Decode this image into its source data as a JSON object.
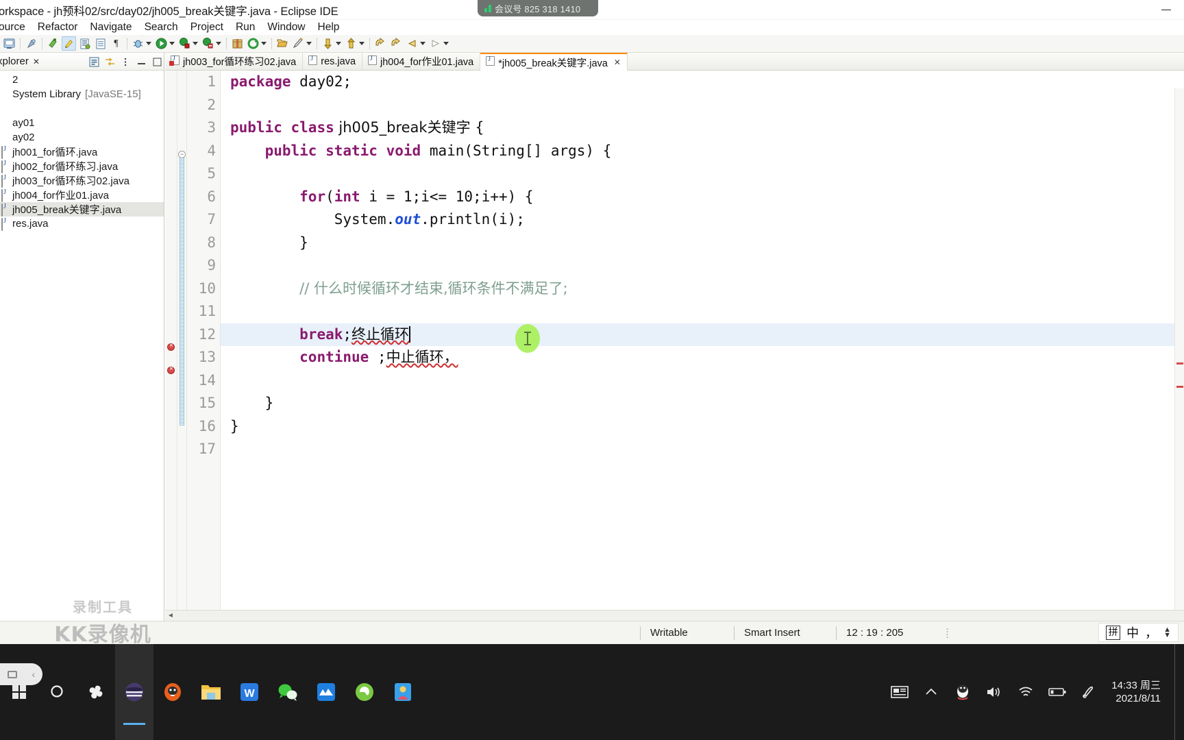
{
  "window": {
    "title": "orkspace - jh预科02/src/day02/jh005_break关键字.java - Eclipse IDE",
    "minimize_label": "—"
  },
  "meeting_overlay": {
    "label": "会议号 825 318 1410"
  },
  "menubar": {
    "items": [
      {
        "label": "ource"
      },
      {
        "label": "Refactor"
      },
      {
        "label": "Navigate"
      },
      {
        "label": "Search"
      },
      {
        "label": "Project"
      },
      {
        "label": "Run"
      },
      {
        "label": "Window"
      },
      {
        "label": "Help"
      }
    ]
  },
  "toolbar": {
    "icons": [
      "new-java-project-icon",
      "separator",
      "save-icon",
      "separator",
      "toggle-mark-occurrences-icon",
      "toggle-highlight-icon",
      "open-task-icon",
      "show-whitespace-icon",
      "pilcrow-icon",
      "separator",
      "debug-icon",
      "debug-dropdown-icon",
      "run-icon",
      "run-dropdown-icon",
      "external-tools-icon",
      "external-tools-dropdown-icon",
      "coverage-icon",
      "coverage-dropdown-icon",
      "separator",
      "new-package-icon",
      "refresh-icon",
      "refresh-dropdown-icon",
      "separator",
      "open-type-icon",
      "search-icon",
      "search-dropdown-icon",
      "separator",
      "previous-annotation-icon",
      "annotation-dropdown-icon",
      "next-annotation-icon",
      "next-dropdown-icon",
      "separator",
      "back-icon",
      "forward-icon",
      "back-history-icon",
      "back-history-dropdown-icon",
      "forward-history-icon",
      "forward-history-dropdown-icon"
    ]
  },
  "explorer": {
    "tab_label": "xplorer",
    "tab_close": "✕",
    "tools": [
      "collapse-all-icon",
      "link-with-editor-icon",
      "view-menu-icon",
      "minimize-icon",
      "maximize-icon"
    ],
    "tree": [
      {
        "label": "2",
        "icon": "project-icon",
        "selected": false,
        "error": false
      },
      {
        "label": "System Library",
        "suffix": "[JavaSE-15]",
        "icon": "jre-library-icon",
        "selected": false,
        "error": false
      },
      {
        "label": "",
        "icon": "blank-icon",
        "selected": false,
        "error": false
      },
      {
        "label": "ay01",
        "icon": "package-icon",
        "selected": false,
        "error": false
      },
      {
        "label": "ay02",
        "icon": "package-icon",
        "selected": false,
        "error": false
      },
      {
        "label": "jh001_for循环.java",
        "icon": "java-file-icon",
        "selected": false,
        "error": false
      },
      {
        "label": "jh002_for循环练习.java",
        "icon": "java-file-icon",
        "selected": false,
        "error": false
      },
      {
        "label": "jh003_for循环练习02.java",
        "icon": "java-file-icon",
        "selected": false,
        "error": false
      },
      {
        "label": "jh004_for作业01.java",
        "icon": "java-file-icon",
        "selected": false,
        "error": false
      },
      {
        "label": "jh005_break关键字.java",
        "icon": "java-file-icon",
        "selected": true,
        "error": false
      },
      {
        "label": "res.java",
        "icon": "java-file-icon",
        "selected": false,
        "error": false
      }
    ]
  },
  "editor": {
    "tabs": [
      {
        "label": "jh003_for循环练习02.java",
        "active": false,
        "error": true,
        "dirty": false
      },
      {
        "label": "res.java",
        "active": false,
        "error": false,
        "dirty": false
      },
      {
        "label": "jh004_for作业01.java",
        "active": false,
        "error": false,
        "dirty": false
      },
      {
        "label": "*jh005_break关键字.java",
        "active": true,
        "error": false,
        "dirty": true,
        "close": "✕"
      }
    ],
    "line_numbers": [
      "1",
      "2",
      "3",
      "4",
      "5",
      "6",
      "7",
      "8",
      "9",
      "10",
      "11",
      "12",
      "13",
      "14",
      "15",
      "16",
      "17"
    ],
    "lines": [
      {
        "n": 1,
        "text": "package day02;"
      },
      {
        "n": 2,
        "text": ""
      },
      {
        "n": 3,
        "text": "public class jh005_break关键字 {"
      },
      {
        "n": 4,
        "text": "    public static void main(String[] args) {"
      },
      {
        "n": 5,
        "text": ""
      },
      {
        "n": 6,
        "text": "        for(int i = 1;i<= 10;i++) {"
      },
      {
        "n": 7,
        "text": "            System.out.println(i);"
      },
      {
        "n": 8,
        "text": "        }"
      },
      {
        "n": 9,
        "text": ""
      },
      {
        "n": 10,
        "text": "        // 什么时候循环才结束,循环条件不满足了;"
      },
      {
        "n": 11,
        "text": ""
      },
      {
        "n": 12,
        "text": "        break;终止循环"
      },
      {
        "n": 13,
        "text": "        continue ;中止循环，"
      },
      {
        "n": 14,
        "text": ""
      },
      {
        "n": 15,
        "text": "    }"
      },
      {
        "n": 16,
        "text": "}"
      },
      {
        "n": 17,
        "text": ""
      }
    ],
    "tokens": {
      "l1_kw": "package",
      "l1_rest": " day02;",
      "l3_kw1": "public",
      "l3_kw2": "class",
      "l3_name": " jh005_break关键字 {",
      "l4_kw1": "public",
      "l4_kw2": "static",
      "l4_kw3": "void",
      "l4_rest": " main(String[] args) {",
      "l6_kw1": "for",
      "l6_open": "(",
      "l6_kw2": "int",
      "l6_rest": " i = 1;i<= 10;i++) {",
      "l7_a": "System.",
      "l7_fld": "out",
      "l7_b": ".println(i);",
      "l8": "}",
      "l10_comment": "// 什么时候循环才结束,循环条件不满足了;",
      "l12_kw": "break",
      "l12_semi": ";",
      "l12_zh": "终止循环",
      "l13_kw": "continue",
      "l13_semi": " ;",
      "l13_zh": "中止循环，",
      "l15": "}",
      "l16": "}"
    },
    "error_lines": [
      12,
      13
    ],
    "highlight_line": 12
  },
  "statusbar": {
    "writable": "Writable",
    "insert_mode": "Smart Insert",
    "position": "12 : 19 : 205"
  },
  "ime": {
    "mode_box": "拼",
    "language": "中",
    "punctuation": "，"
  },
  "watermark": {
    "top_text": "录制工具",
    "main_text": "KK录像机"
  },
  "taskbar": {
    "apps": [
      {
        "name": "start-icon",
        "color": "#ffffff"
      },
      {
        "name": "search-icon",
        "color": "#ffffff"
      },
      {
        "name": "cortana-icon",
        "color": "#ffffff"
      },
      {
        "name": "eclipse-icon",
        "color": "#463a6b"
      },
      {
        "name": "firefox-icon",
        "color": "#e8601c"
      },
      {
        "name": "file-explorer-icon",
        "color": "#f5c242"
      },
      {
        "name": "wps-writer-icon",
        "color": "#2a7ae0"
      },
      {
        "name": "wechat-icon",
        "color": "#3ec93e"
      },
      {
        "name": "xunlei-icon",
        "color": "#1f7fe0"
      },
      {
        "name": "browser-icon",
        "color": "#7ac943"
      },
      {
        "name": "contacts-icon",
        "color": "#3aa0e8"
      }
    ],
    "tray": [
      "news-icon",
      "show-hidden-icons-icon",
      "qq-icon",
      "volume-icon",
      "wifi-icon",
      "battery-icon",
      "pen-icon"
    ],
    "clock_time": "14:33 周三",
    "clock_date": "2021/8/11"
  }
}
